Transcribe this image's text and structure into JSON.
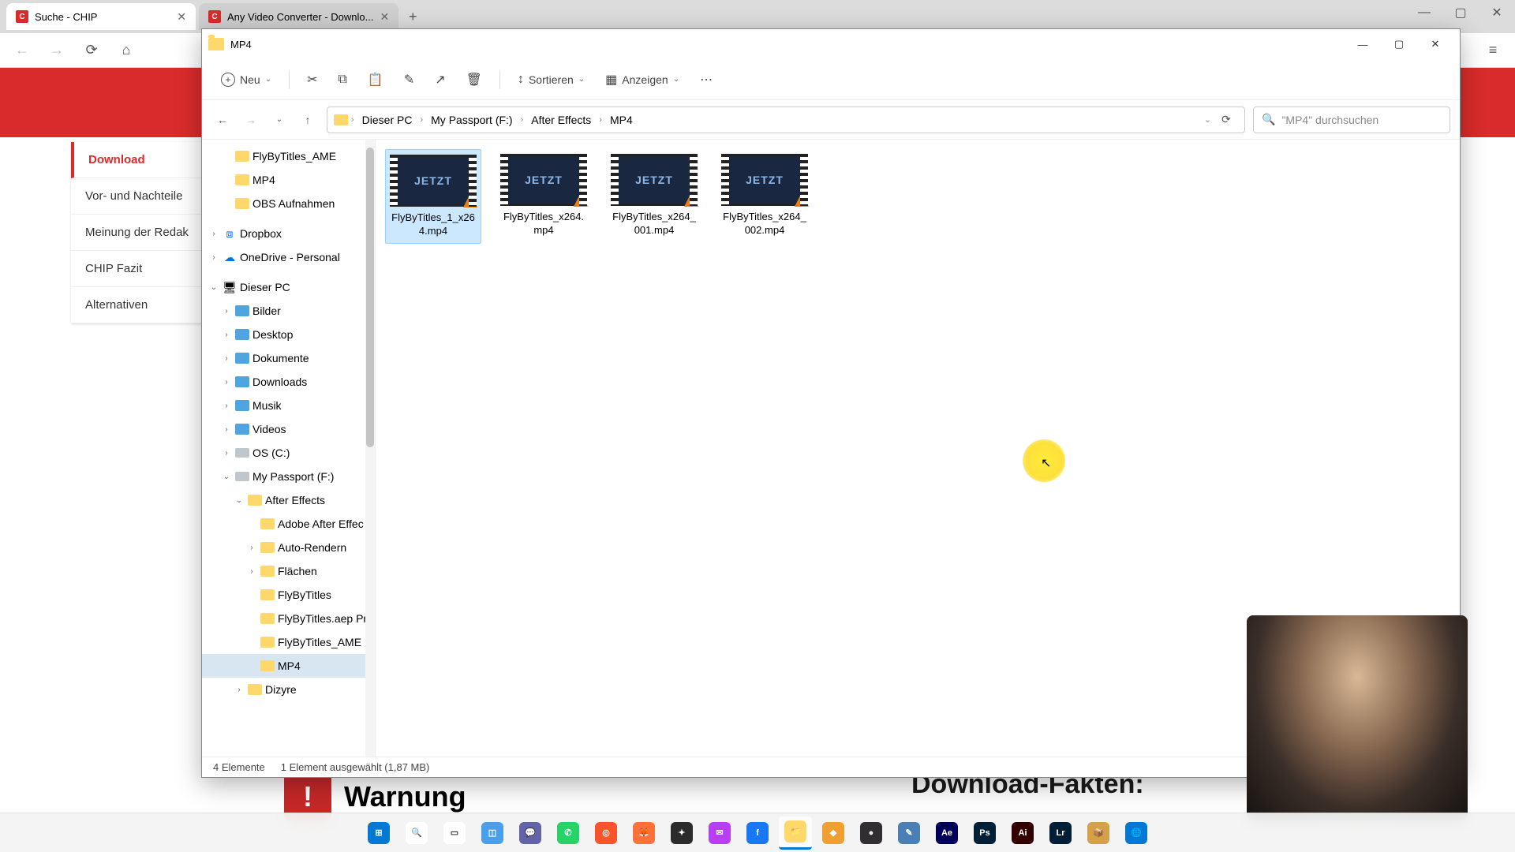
{
  "browser": {
    "tabs": [
      {
        "title": "Suche - CHIP",
        "favicon": "C"
      },
      {
        "title": "Any Video Converter - Downlo...",
        "favicon": "C"
      }
    ],
    "win_min": "—",
    "win_max": "▢",
    "win_close": "✕"
  },
  "chip_sidebar": {
    "items": [
      "Download",
      "Vor- und Nachteile",
      "Meinung der Redak",
      "CHIP Fazit",
      "Alternativen"
    ]
  },
  "warning": {
    "label": "Warnung",
    "icon": "!"
  },
  "download_fakten": "Download-Fakten:",
  "explorer": {
    "title": "MP4",
    "toolbar": {
      "neu": "Neu",
      "sortieren": "Sortieren",
      "anzeigen": "Anzeigen"
    },
    "breadcrumb": [
      "Dieser PC",
      "My Passport (F:)",
      "After Effects",
      "MP4"
    ],
    "search_placeholder": "\"MP4\" durchsuchen",
    "nav": [
      {
        "label": "FlyByTitles_AME",
        "indent": 1,
        "chev": "",
        "icon": "folder"
      },
      {
        "label": "MP4",
        "indent": 1,
        "chev": "",
        "icon": "folder"
      },
      {
        "label": "OBS Aufnahmen",
        "indent": 1,
        "chev": "",
        "icon": "folder"
      },
      {
        "label": "Dropbox",
        "indent": 0,
        "chev": "›",
        "icon": "dropbox"
      },
      {
        "label": "OneDrive - Personal",
        "indent": 0,
        "chev": "›",
        "icon": "onedrive"
      },
      {
        "label": "Dieser PC",
        "indent": 0,
        "chev": "⌄",
        "icon": "pc"
      },
      {
        "label": "Bilder",
        "indent": 1,
        "chev": "›",
        "icon": "blue"
      },
      {
        "label": "Desktop",
        "indent": 1,
        "chev": "›",
        "icon": "blue"
      },
      {
        "label": "Dokumente",
        "indent": 1,
        "chev": "›",
        "icon": "blue"
      },
      {
        "label": "Downloads",
        "indent": 1,
        "chev": "›",
        "icon": "blue"
      },
      {
        "label": "Musik",
        "indent": 1,
        "chev": "›",
        "icon": "blue"
      },
      {
        "label": "Videos",
        "indent": 1,
        "chev": "›",
        "icon": "blue"
      },
      {
        "label": "OS (C:)",
        "indent": 1,
        "chev": "›",
        "icon": "drive"
      },
      {
        "label": "My Passport (F:)",
        "indent": 1,
        "chev": "⌄",
        "icon": "drive"
      },
      {
        "label": "After Effects",
        "indent": 2,
        "chev": "⌄",
        "icon": "folder"
      },
      {
        "label": "Adobe After Effec",
        "indent": 3,
        "chev": "",
        "icon": "folder"
      },
      {
        "label": "Auto-Rendern",
        "indent": 3,
        "chev": "›",
        "icon": "folder"
      },
      {
        "label": "Flächen",
        "indent": 3,
        "chev": "›",
        "icon": "folder"
      },
      {
        "label": "FlyByTitles",
        "indent": 3,
        "chev": "",
        "icon": "folder"
      },
      {
        "label": "FlyByTitles.aep Pro",
        "indent": 3,
        "chev": "",
        "icon": "folder"
      },
      {
        "label": "FlyByTitles_AME",
        "indent": 3,
        "chev": "",
        "icon": "folder"
      },
      {
        "label": "MP4",
        "indent": 3,
        "chev": "",
        "icon": "folder",
        "selected": true
      },
      {
        "label": "Dizyre",
        "indent": 2,
        "chev": "›",
        "icon": "folder"
      }
    ],
    "files": [
      {
        "name": "FlyByTitles_1_x264.mp4",
        "thumb": "JETZT",
        "selected": true
      },
      {
        "name": "FlyByTitles_x264.mp4",
        "thumb": "JETZT",
        "selected": false
      },
      {
        "name": "FlyByTitles_x264_001.mp4",
        "thumb": "JETZT",
        "selected": false
      },
      {
        "name": "FlyByTitles_x264_002.mp4",
        "thumb": "JETZT",
        "selected": false
      }
    ],
    "status": {
      "count": "4 Elemente",
      "selected": "1 Element ausgewählt (1,87 MB)"
    }
  },
  "taskbar": {
    "apps": [
      {
        "name": "start",
        "color": "#0078d4",
        "glyph": "⊞"
      },
      {
        "name": "search",
        "color": "#ffffff",
        "glyph": "🔍"
      },
      {
        "name": "taskview",
        "color": "#ffffff",
        "glyph": "▭"
      },
      {
        "name": "widgets",
        "color": "#4aa0e8",
        "glyph": "◫"
      },
      {
        "name": "teams",
        "color": "#6264a7",
        "glyph": "💬"
      },
      {
        "name": "whatsapp",
        "color": "#25d366",
        "glyph": "✆"
      },
      {
        "name": "brave",
        "color": "#fb542b",
        "glyph": "◎"
      },
      {
        "name": "firefox",
        "color": "#ff7139",
        "glyph": "🦊"
      },
      {
        "name": "app1",
        "color": "#2b2b2b",
        "glyph": "✦"
      },
      {
        "name": "messenger",
        "color": "#b93df3",
        "glyph": "✉"
      },
      {
        "name": "facebook",
        "color": "#1877f2",
        "glyph": "f"
      },
      {
        "name": "explorer",
        "color": "#ffd86b",
        "glyph": "📁",
        "active": true
      },
      {
        "name": "app2",
        "color": "#f0a030",
        "glyph": "◆"
      },
      {
        "name": "obs",
        "color": "#302e31",
        "glyph": "●"
      },
      {
        "name": "app3",
        "color": "#4a7fb5",
        "glyph": "✎"
      },
      {
        "name": "aftereffects",
        "color": "#00005b",
        "glyph": "Ae"
      },
      {
        "name": "photoshop",
        "color": "#001e36",
        "glyph": "Ps"
      },
      {
        "name": "illustrator",
        "color": "#330000",
        "glyph": "Ai"
      },
      {
        "name": "lightroom",
        "color": "#001e36",
        "glyph": "Lr"
      },
      {
        "name": "app4",
        "color": "#d4a04a",
        "glyph": "📦"
      },
      {
        "name": "edge",
        "color": "#0078d4",
        "glyph": "🌐"
      }
    ]
  }
}
